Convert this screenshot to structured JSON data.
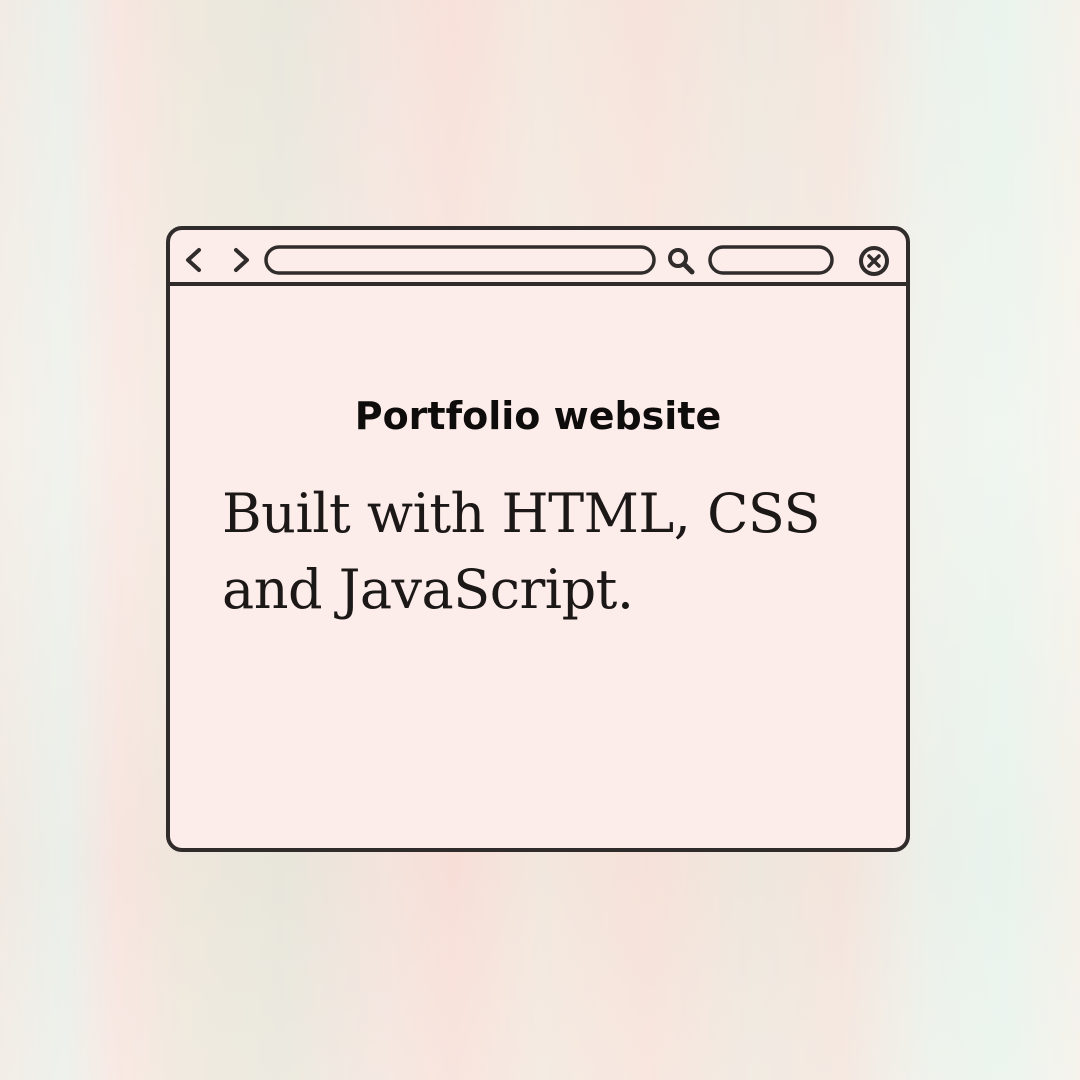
{
  "window": {
    "toolbar": {
      "icons": [
        "back-icon",
        "forward-icon",
        "search-icon",
        "close-icon"
      ],
      "address_bar_value": "",
      "secondary_field_value": ""
    },
    "content": {
      "title": "Portfolio website",
      "body": "Built with HTML, CSS and JavaScript."
    }
  },
  "colors": {
    "window_fill": "#fdedea",
    "outline": "#2f2c2b",
    "text": "#0f0d0c"
  }
}
